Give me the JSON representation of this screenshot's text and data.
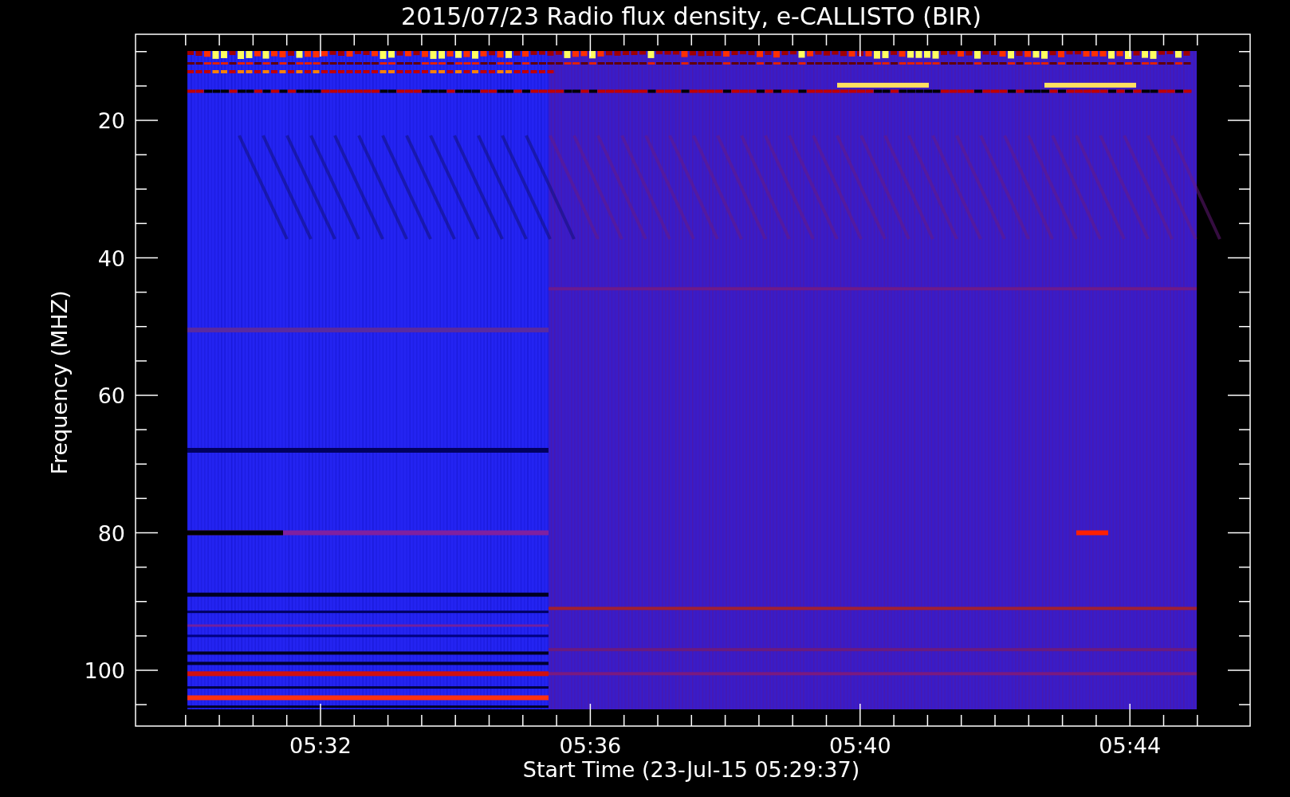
{
  "title": "2015/07/23  Radio flux density, e-CALLISTO (BIR)",
  "y_axis": {
    "label": "Frequency (MHZ)",
    "ticks": [
      "20",
      "40",
      "60",
      "80",
      "100"
    ]
  },
  "x_axis": {
    "label": "Start Time (23-Jul-15 05:29:37)",
    "ticks": [
      "05:32",
      "05:36",
      "05:40",
      "05:44"
    ]
  }
}
